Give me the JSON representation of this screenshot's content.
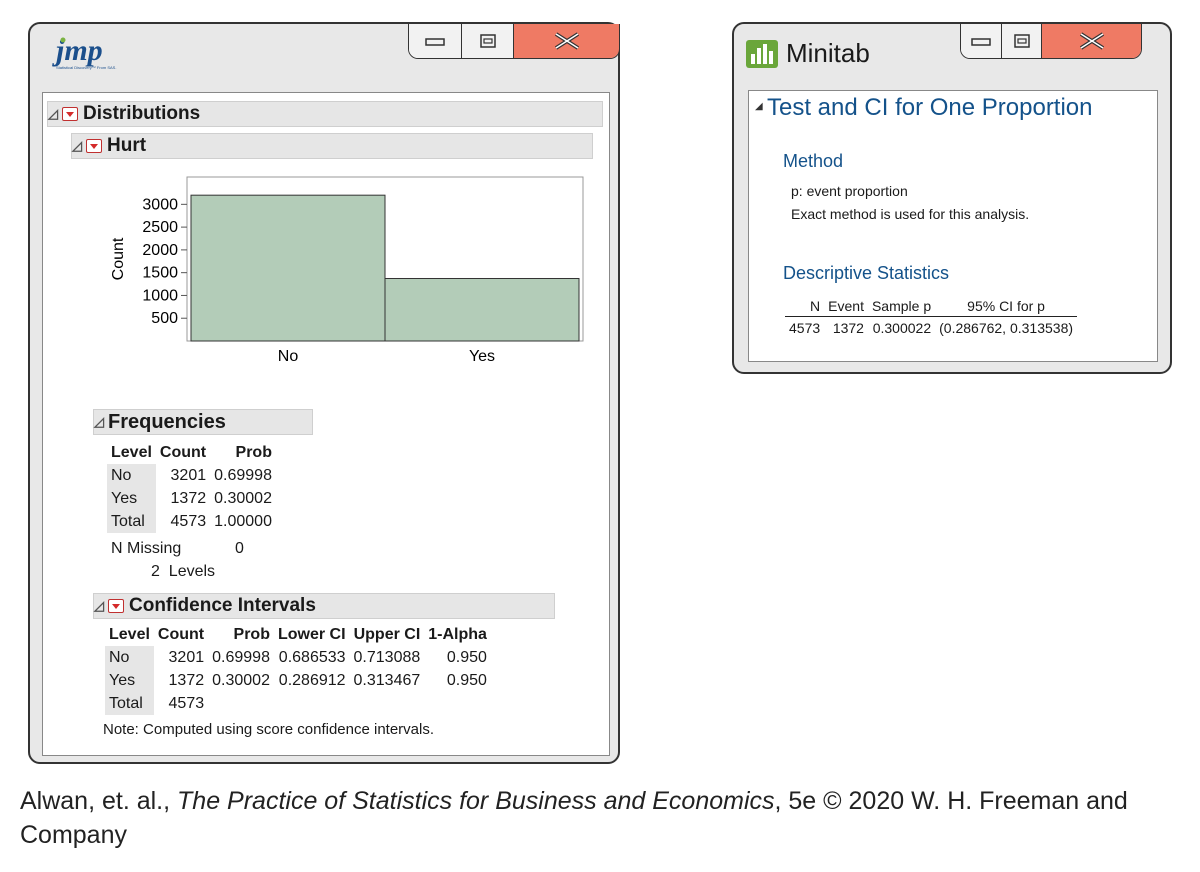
{
  "jmp": {
    "logo_text": "jmp",
    "logo_sub": "Statistical Discovery™ From SAS.",
    "distributions_title": "Distributions",
    "hurt_title": "Hurt",
    "chart": {
      "ylabel": "Count",
      "yticks": [
        "3000",
        "2500",
        "2000",
        "1500",
        "1000",
        "500"
      ],
      "xcats": [
        "No",
        "Yes"
      ]
    },
    "frequencies": {
      "title": "Frequencies",
      "headers": [
        "Level",
        "Count",
        "Prob"
      ],
      "rows": [
        [
          "No",
          "3201",
          "0.69998"
        ],
        [
          "Yes",
          "1372",
          "0.30002"
        ],
        [
          "Total",
          "4573",
          "1.00000"
        ]
      ],
      "n_missing_label": "N Missing",
      "n_missing_value": "0",
      "levels_text": "2  Levels"
    },
    "ci": {
      "title": "Confidence Intervals",
      "headers": [
        "Level",
        "Count",
        "Prob",
        "Lower CI",
        "Upper CI",
        "1-Alpha"
      ],
      "rows": [
        [
          "No",
          "3201",
          "0.69998",
          "0.686533",
          "0.713088",
          "0.950"
        ],
        [
          "Yes",
          "1372",
          "0.30002",
          "0.286912",
          "0.313467",
          "0.950"
        ],
        [
          "Total",
          "4573",
          "",
          "",
          "",
          ""
        ]
      ],
      "note": "Note: Computed using score confidence intervals."
    }
  },
  "chart_data": {
    "type": "bar",
    "categories": [
      "No",
      "Yes"
    ],
    "values": [
      3201,
      1372
    ],
    "xlabel": "",
    "ylabel": "Count",
    "ylim": [
      0,
      3600
    ],
    "colors": {
      "bar": "#b3ccb8",
      "bar_border": "#333333"
    }
  },
  "minitab": {
    "title": "Minitab",
    "section_title": "Test and CI for One Proportion",
    "method_heading": "Method",
    "method_lines": [
      "p: event proportion",
      "Exact method is used for this analysis."
    ],
    "desc_heading": "Descriptive Statistics",
    "table_headers": [
      "N",
      "Event",
      "Sample p",
      "95% CI for p"
    ],
    "table_row": [
      "4573",
      "1372",
      "0.300022",
      "(0.286762, 0.313538)"
    ]
  },
  "caption": {
    "prefix": "Alwan, et. al., ",
    "title": "The Practice of Statistics for Business and Economics",
    "suffix": ", 5e © 2020 W. H. Freeman and Company"
  },
  "colors": {
    "close_button": "#ef7a64",
    "heading_blue": "#14528a",
    "menu_red": "#d42a2a"
  }
}
